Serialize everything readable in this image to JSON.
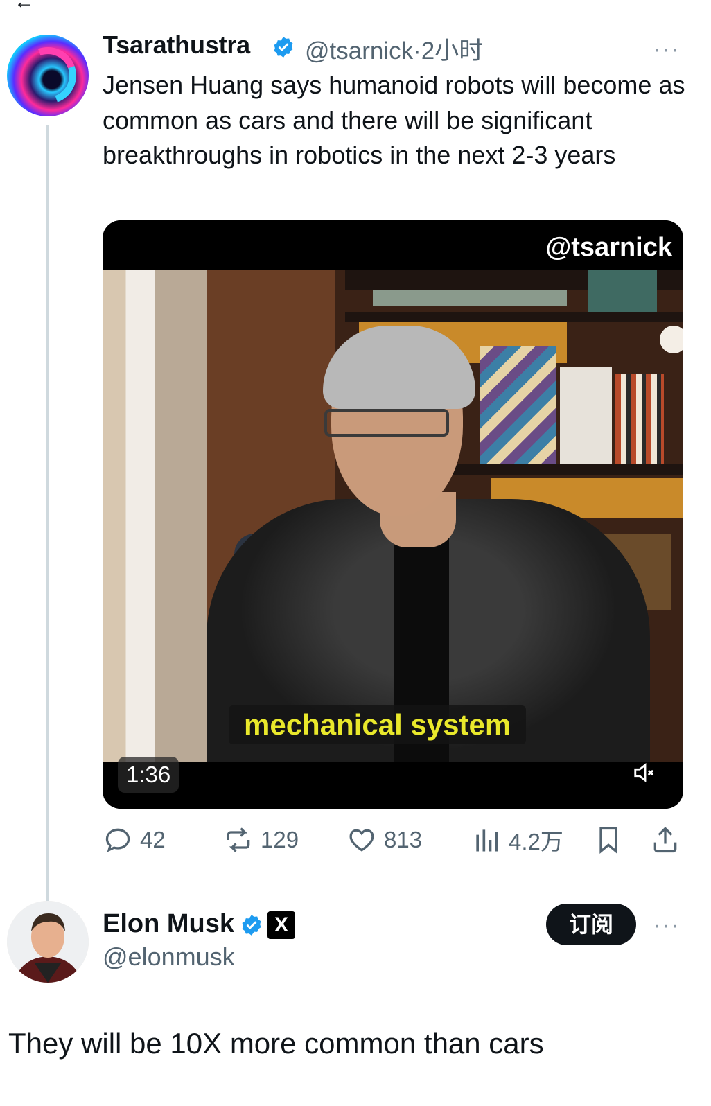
{
  "tweet1": {
    "author_name": "Tsarathustra",
    "handle": "@tsarnick",
    "separator": "·",
    "time": "2小时",
    "text": "Jensen Huang says humanoid robots will become as common as cars and there will be significant breakthroughs in robotics in the next 2-3 years",
    "more": "···",
    "video": {
      "watermark": "@tsarnick",
      "caption": "mechanical system",
      "duration": "1:36",
      "muted": true
    },
    "actions": {
      "replies": "42",
      "reposts": "129",
      "likes": "813",
      "views": "4.2万"
    }
  },
  "tweet2": {
    "author_name": "Elon Musk",
    "handle": "@elonmusk",
    "x_badge": "X",
    "subscribe_label": "订阅",
    "more": "···",
    "text": "They will be 10X more common than cars"
  },
  "colors": {
    "verified": "#1d9bf0",
    "muted_text": "#536471",
    "caption_yellow": "#e9e82b",
    "thread_line": "#cfd9de"
  },
  "icons": [
    "verified-badge-icon",
    "more-icon",
    "mute-icon",
    "reply-icon",
    "repost-icon",
    "like-icon",
    "views-icon",
    "bookmark-icon",
    "share-icon",
    "x-logo-icon"
  ]
}
